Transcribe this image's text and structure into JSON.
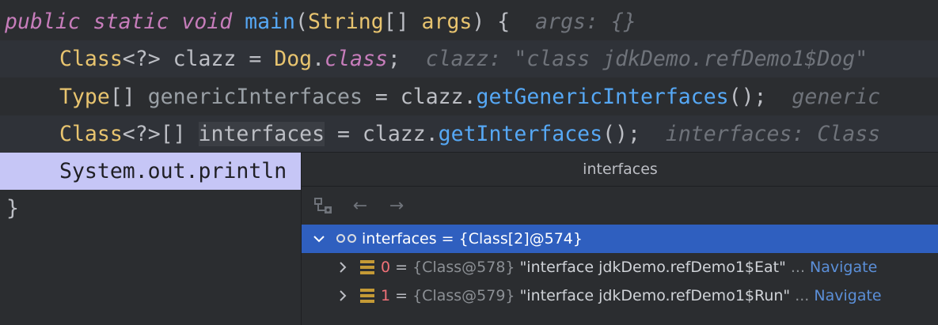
{
  "code": {
    "l1": {
      "kw1": "public static void ",
      "method": "main",
      "p1": "(",
      "type": "String",
      "p2": "[] ",
      "param": "args",
      "p3": ") {",
      "hint": "args: {}"
    },
    "l2": {
      "cls": "Class",
      "p1": "<?> clazz = ",
      "cls2": "Dog",
      "p2": ".",
      "kw": "class",
      "p3": ";",
      "hint": "clazz: \"class jdkDemo.refDemo1$Dog\""
    },
    "l3": {
      "cls": "Type",
      "p1": "[] ",
      "var": "genericInterfaces",
      "p2": " = clazz.",
      "method": "getGenericInterfaces",
      "p3": "();",
      "hint": "generic"
    },
    "l4": {
      "cls": "Class",
      "p1": "<?>[] ",
      "var": "interfaces",
      "p2": " = clazz.",
      "method": "getInterfaces",
      "p3": "();",
      "hint": "interfaces: Class"
    },
    "l5": {
      "text": "System.out.println"
    },
    "l6": {
      "text": "}"
    }
  },
  "popup": {
    "title": "interfaces",
    "toolbar": {
      "icon1": "show-types-icon",
      "back": "←",
      "forward": "→"
    },
    "root": {
      "label": "interfaces = {Class[2]@574}"
    },
    "items": [
      {
        "index": "0",
        "eq": " = ",
        "addr": "{Class@578}",
        "value": " \"interface jdkDemo.refDemo1$Eat\"",
        "dots": " ...",
        "nav": " Navigate"
      },
      {
        "index": "1",
        "eq": " = ",
        "addr": "{Class@579}",
        "value": " \"interface jdkDemo.refDemo1$Run\"",
        "dots": " ...",
        "nav": " Navigate"
      }
    ]
  },
  "colors": {
    "selection": "#2f5fbf",
    "exec_line": "#c6c6f6",
    "keyword": "#c77dbb",
    "method": "#56a8f5",
    "type": "#e8c46f"
  }
}
